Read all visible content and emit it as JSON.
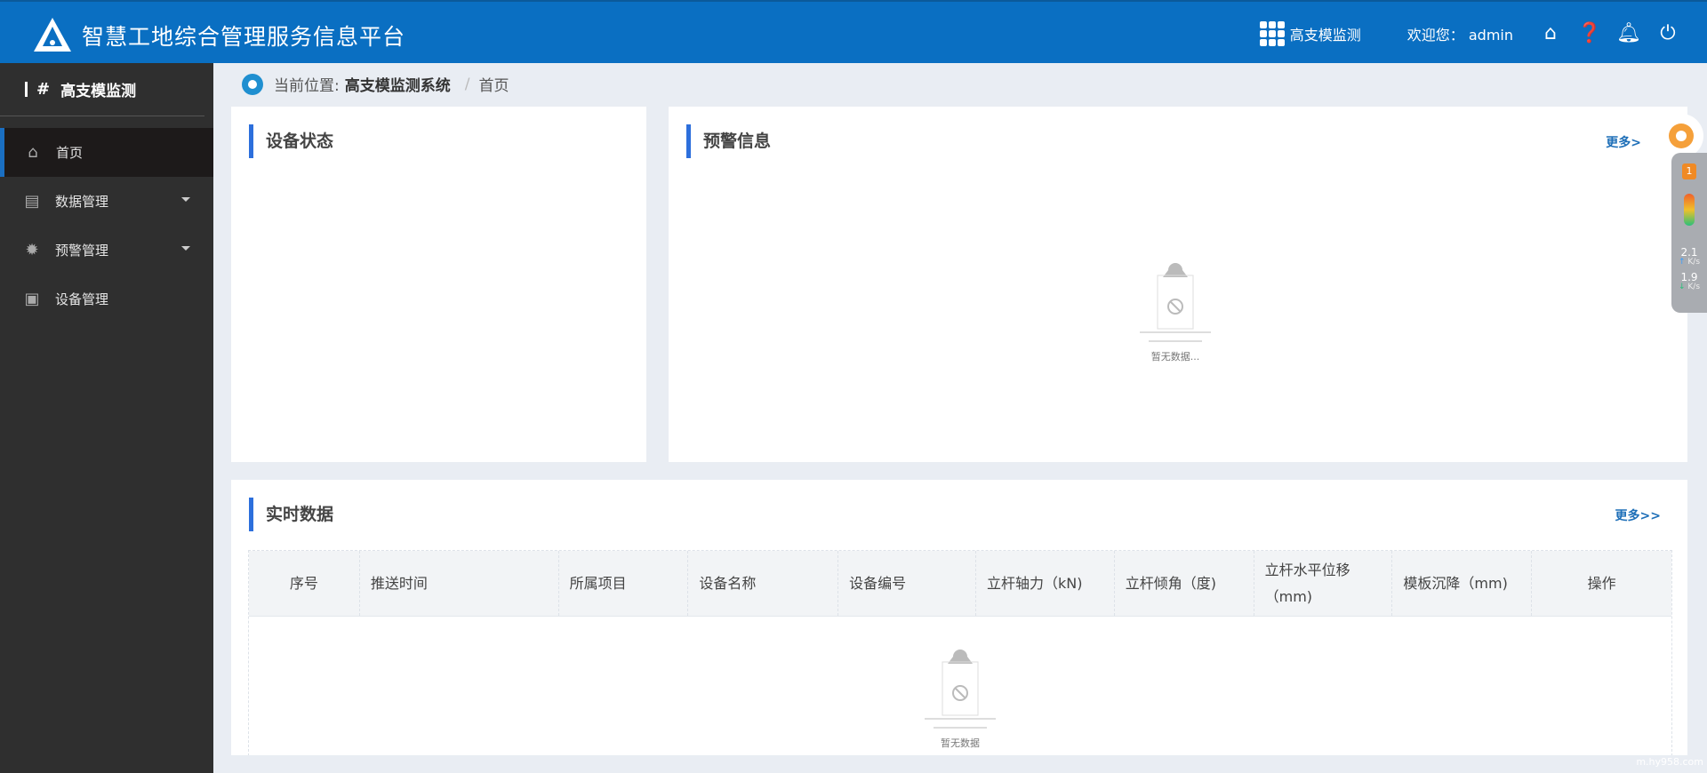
{
  "header": {
    "title": "智慧工地综合管理服务信息平台",
    "app_switch_label": "高支模监测",
    "welcome": "欢迎您：",
    "username": "admin",
    "icons": [
      "home-icon",
      "help-icon",
      "bell-icon",
      "power-icon"
    ]
  },
  "sidebar": {
    "title": "高支模监测",
    "items": [
      {
        "label": "首页",
        "icon": "home-icon",
        "active": true
      },
      {
        "label": "数据管理",
        "icon": "data-icon",
        "has_caret": true
      },
      {
        "label": "预警管理",
        "icon": "alarm-icon",
        "has_caret": true
      },
      {
        "label": "设备管理",
        "icon": "device-icon"
      }
    ]
  },
  "breadcrumb": {
    "prefix": "当前位置:",
    "system": "高支模监测系统",
    "separator": "/",
    "current": "首页"
  },
  "panels": {
    "device_status": {
      "title": "设备状态"
    },
    "warning": {
      "title": "预警信息",
      "more": "更多>",
      "empty": "暂无数据..."
    },
    "realtime": {
      "title": "实时数据",
      "more": "更多>>",
      "empty": "暂无数据",
      "columns": [
        "序号",
        "推送时间",
        "所属项目",
        "设备名称",
        "设备编号",
        "立杆轴力（kN)",
        "立杆倾角（度)",
        "立杆水平位移（mm)",
        "模板沉降（mm)",
        "操作"
      ]
    }
  },
  "widget": {
    "up": "2.1",
    "down": "1.9",
    "unit": "K/s",
    "badge": "1"
  },
  "watermark": "m.hy958.com",
  "colors": {
    "header": "#0a6fc2",
    "sidebar": "#2f2f2f",
    "accent": "#2d6fdc",
    "link": "#1e6fb8"
  }
}
